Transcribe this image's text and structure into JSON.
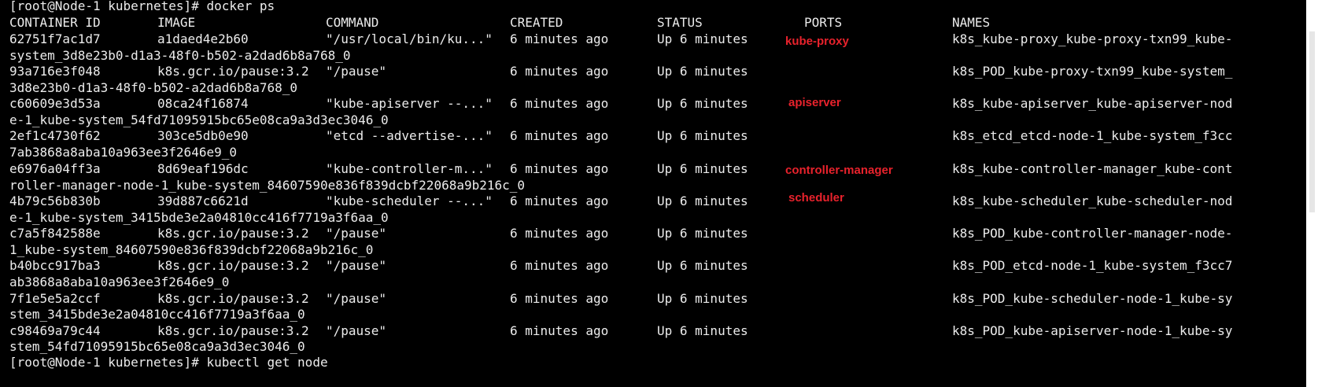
{
  "terminal": {
    "prompt_line": "[root@Node-1 kubernetes]# docker ps",
    "next_prompt_line": "[root@Node-1 kubernetes]# kubectl get node",
    "header": {
      "container_id": "CONTAINER ID",
      "image": "IMAGE",
      "command": "COMMAND",
      "created": "CREATED",
      "status": "STATUS",
      "ports": "PORTS",
      "names": "NAMES"
    },
    "rows": [
      {
        "container_id": "62751f7ac1d7",
        "image": "a1daed4e2b60",
        "command": "\"/usr/local/bin/ku...\"",
        "created": "6 minutes ago",
        "status": "Up 6 minutes",
        "names": "k8s_kube-proxy_kube-proxy-txn99_kube-",
        "wrap": "system_3d8e23b0-d1a3-48f0-b502-a2dad6b8a768_0"
      },
      {
        "container_id": "93a716e3f048",
        "image": "k8s.gcr.io/pause:3.2",
        "command": "\"/pause\"",
        "created": "6 minutes ago",
        "status": "Up 6 minutes",
        "names": "k8s_POD_kube-proxy-txn99_kube-system_",
        "wrap": "3d8e23b0-d1a3-48f0-b502-a2dad6b8a768_0"
      },
      {
        "container_id": "c60609e3d53a",
        "image": "08ca24f16874",
        "command": "\"kube-apiserver --...\"",
        "created": "6 minutes ago",
        "status": "Up 6 minutes",
        "names": "k8s_kube-apiserver_kube-apiserver-nod",
        "wrap": "e-1_kube-system_54fd71095915bc65e08ca9a3d3ec3046_0"
      },
      {
        "container_id": "2ef1c4730f62",
        "image": "303ce5db0e90",
        "command": "\"etcd --advertise-...\"",
        "created": "6 minutes ago",
        "status": "Up 6 minutes",
        "names": "k8s_etcd_etcd-node-1_kube-system_f3cc",
        "wrap": "7ab3868a8aba10a963ee3f2646e9_0"
      },
      {
        "container_id": "e6976a04ff3a",
        "image": "8d69eaf196dc",
        "command": "\"kube-controller-m...\"",
        "created": "6 minutes ago",
        "status": "Up 6 minutes",
        "names": "k8s_kube-controller-manager_kube-cont",
        "wrap": "roller-manager-node-1_kube-system_84607590e836f839dcbf22068a9b216c_0"
      },
      {
        "container_id": "4b79c56b830b",
        "image": "39d887c6621d",
        "command": "\"kube-scheduler --...\"",
        "created": "6 minutes ago",
        "status": "Up 6 minutes",
        "names": "k8s_kube-scheduler_kube-scheduler-nod",
        "wrap": "e-1_kube-system_3415bde3e2a04810cc416f7719a3f6aa_0"
      },
      {
        "container_id": "c7a5f842588e",
        "image": "k8s.gcr.io/pause:3.2",
        "command": "\"/pause\"",
        "created": "6 minutes ago",
        "status": "Up 6 minutes",
        "names": "k8s_POD_kube-controller-manager-node-",
        "wrap": "1_kube-system_84607590e836f839dcbf22068a9b216c_0"
      },
      {
        "container_id": "b40bcc917ba3",
        "image": "k8s.gcr.io/pause:3.2",
        "command": "\"/pause\"",
        "created": "6 minutes ago",
        "status": "Up 6 minutes",
        "names": "k8s_POD_etcd-node-1_kube-system_f3cc7",
        "wrap": "ab3868a8aba10a963ee3f2646e9_0"
      },
      {
        "container_id": "7f1e5e5a2ccf",
        "image": "k8s.gcr.io/pause:3.2",
        "command": "\"/pause\"",
        "created": "6 minutes ago",
        "status": "Up 6 minutes",
        "names": "k8s_POD_kube-scheduler-node-1_kube-sy",
        "wrap": "stem_3415bde3e2a04810cc416f7719a3f6aa_0"
      },
      {
        "container_id": "c98469a79c44",
        "image": "k8s.gcr.io/pause:3.2",
        "command": "\"/pause\"",
        "created": "6 minutes ago",
        "status": "Up 6 minutes",
        "names": "k8s_POD_kube-apiserver-node-1_kube-sy",
        "wrap": "stem_54fd71095915bc65e08ca9a3d3ec3046_0"
      }
    ],
    "annotations": {
      "kube_proxy": "kube-proxy",
      "apiserver": "apiserver",
      "controller_manager": "controller-manager",
      "scheduler": "scheduler"
    },
    "annotation_color": "#e8222c",
    "text_color": "#ececec",
    "background_color": "#000000"
  }
}
